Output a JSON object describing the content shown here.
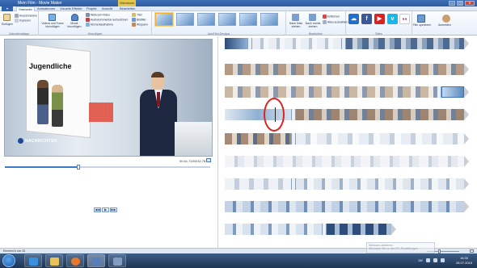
{
  "window": {
    "title": "Mein Film - Movie Maker",
    "context_tab": "Videotools",
    "controls": [
      "–",
      "▢",
      "✕"
    ]
  },
  "tabs": {
    "file": "▾",
    "items": [
      "Startseite",
      "Animationen",
      "Visuelle Effekte",
      "Projekt",
      "Ansicht",
      "Bearbeiten"
    ],
    "active_index": 0
  },
  "ribbon": {
    "clipboard": {
      "paste": "Einfügen",
      "group": "Zwischenablage",
      "cut": "Ausschneiden",
      "copy": "Kopieren"
    },
    "add": {
      "add_video": "Videos und Fotos hinzufügen",
      "add_music": "Musik hinzufügen",
      "webcam": "Webcam-Video",
      "narration": "Audiokommentar aufzeichnen",
      "snapshot": "Momentaufnahme",
      "title": "Titel",
      "caption": "Bildtitel",
      "credits": "Abspann",
      "group": "Hinzufügen"
    },
    "automovie": {
      "group": "AutoFilm-Designs"
    },
    "editing": {
      "rotate_left": "Nach links drehen",
      "rotate_right": "Nach rechts drehen",
      "remove": "Entfernen",
      "select_all": "Alles auswählen",
      "group": "Bearbeiten"
    },
    "share": {
      "group": "Teilen",
      "services": [
        {
          "name": "skydrive-icon",
          "glyph": "☁",
          "color": "#1f6fd0"
        },
        {
          "name": "facebook-icon",
          "glyph": "f",
          "color": "#3b5998"
        },
        {
          "name": "youtube-icon",
          "glyph": "▶",
          "color": "#d22"
        },
        {
          "name": "vimeo-icon",
          "glyph": "v",
          "color": "#1ab7ea"
        },
        {
          "name": "flickr-icon",
          "glyph": "●●",
          "color": "#ffffff"
        }
      ],
      "save_movie": "Film speichern",
      "sign_in": "Anmelden"
    }
  },
  "preview": {
    "overlay_title": "Jugendliche",
    "logo_text": "NACHRICHTEN",
    "timecode": "00:41,71/03:52,78",
    "seek_fraction": 0.36,
    "controls": [
      "◀◀",
      "▶",
      "▶▶"
    ]
  },
  "status": {
    "text": "Element 6 von 33"
  },
  "notification": {
    "line1": "Windows aktivieren",
    "line2": "Wechseln Sie zu den PC-Einstellungen."
  },
  "taskbar": {
    "time": "16:30",
    "date": "28.07.2015",
    "lang": "DE"
  }
}
